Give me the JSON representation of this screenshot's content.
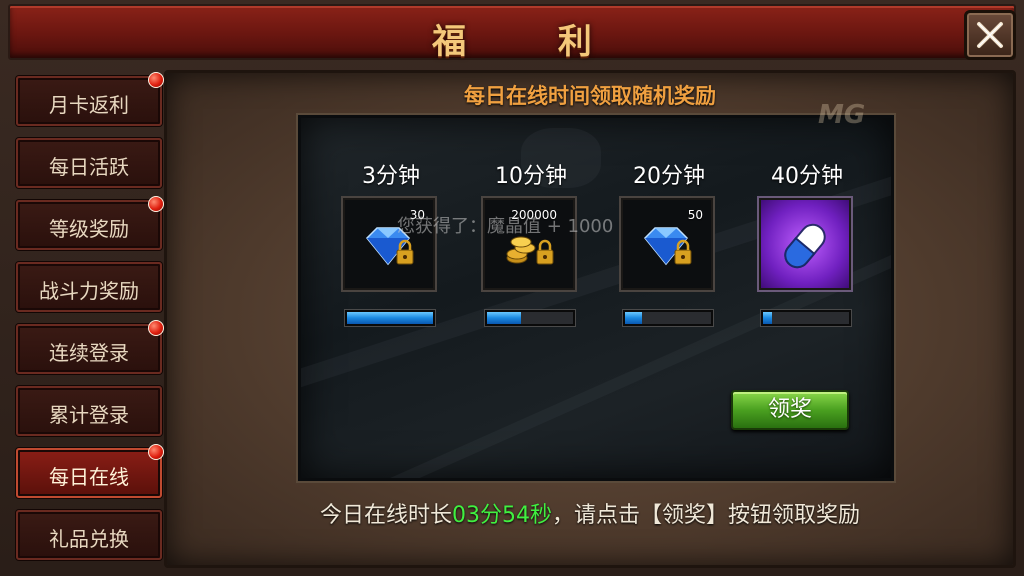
{
  "title": "福  利",
  "watermark": "MG",
  "sidebar": {
    "items": [
      {
        "label": "月卡返利",
        "badge": true,
        "active": false
      },
      {
        "label": "每日活跃",
        "badge": false,
        "active": false
      },
      {
        "label": "等级奖励",
        "badge": true,
        "active": false
      },
      {
        "label": "战斗力奖励",
        "badge": false,
        "active": false
      },
      {
        "label": "连续登录",
        "badge": true,
        "active": false
      },
      {
        "label": "累计登录",
        "badge": false,
        "active": false
      },
      {
        "label": "每日在线",
        "badge": true,
        "active": true
      },
      {
        "label": "礼品兑换",
        "badge": false,
        "active": false
      }
    ]
  },
  "main": {
    "heading": "每日在线时间领取随机奖励",
    "gain_text": "您获得了：魔晶值 + 1000",
    "rewards": [
      {
        "time": "3分钟",
        "count": "30",
        "icon": "diamond-lock-icon",
        "progress": 1.0
      },
      {
        "time": "10分钟",
        "count": "200000",
        "icon": "gold-coins-lock-icon",
        "progress": 0.4
      },
      {
        "time": "20分钟",
        "count": "50",
        "icon": "diamond-lock-icon",
        "progress": 0.2
      },
      {
        "time": "40分钟",
        "count": "",
        "icon": "purple-capsule-icon",
        "progress": 0.1
      }
    ],
    "claim_label": "领奖",
    "footer": {
      "prefix": "今日在线时长",
      "time": "03分54秒",
      "suffix": "，请点击【领奖】按钮领取奖励"
    }
  },
  "colors": {
    "title_gold": "#f4c87a",
    "heading_orange": "#f0a040",
    "progress_blue": "#1a88e0",
    "claim_green": "#4aa020",
    "online_time_green": "#40f040"
  }
}
